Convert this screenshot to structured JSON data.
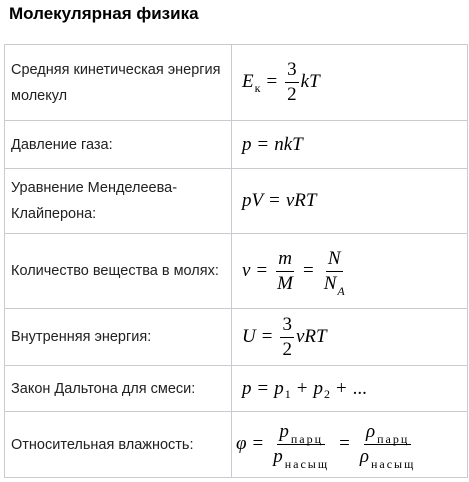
{
  "page": {
    "title": "Молекулярная физика"
  },
  "rows": [
    {
      "label": "Средняя кинетическая энергия молекул",
      "formula": {
        "lhs": "E",
        "lhs_sub": "к",
        "eq": "=",
        "frac_num": "3",
        "frac_den": "2",
        "tail": "kT"
      }
    },
    {
      "label": "Давление газа:",
      "formula": {
        "lhs": "p",
        "eq": "=",
        "rhs": "nkT"
      }
    },
    {
      "label": "Уравнение Менделеева-Клайперона:",
      "formula": {
        "lhs": "pV",
        "eq": "=",
        "rhs": "νRT"
      }
    },
    {
      "label": "Количество вещества в молях:",
      "formula": {
        "lhs": "ν",
        "eq": "=",
        "frac1_num": "m",
        "frac1_den": "M",
        "eq2": "=",
        "frac2_num": "N",
        "frac2_den": "N",
        "frac2_den_sub": "A"
      }
    },
    {
      "label": "Внутренняя энергия:",
      "formula": {
        "lhs": "U",
        "eq": "=",
        "frac_num": "3",
        "frac_den": "2",
        "tail": "νRT"
      }
    },
    {
      "label": "Закон Дальтона для смеси:",
      "formula": {
        "lhs": "p",
        "eq": "=",
        "t1": "p",
        "t1_sub": "1",
        "plus1": "+",
        "t2": "p",
        "t2_sub": "2",
        "plus2": "+",
        "ellipsis": "..."
      }
    },
    {
      "label": "Относительная влажность:",
      "formula": {
        "lhs": "φ",
        "eq": "=",
        "frac1_num": "p",
        "frac1_num_sub": "парц",
        "frac1_den": "p",
        "frac1_den_sub": "насыщ",
        "eq2": "=",
        "frac2_num": "ρ",
        "frac2_num_sub": "парц",
        "frac2_den": "ρ",
        "frac2_den_sub": "насыщ"
      }
    }
  ]
}
